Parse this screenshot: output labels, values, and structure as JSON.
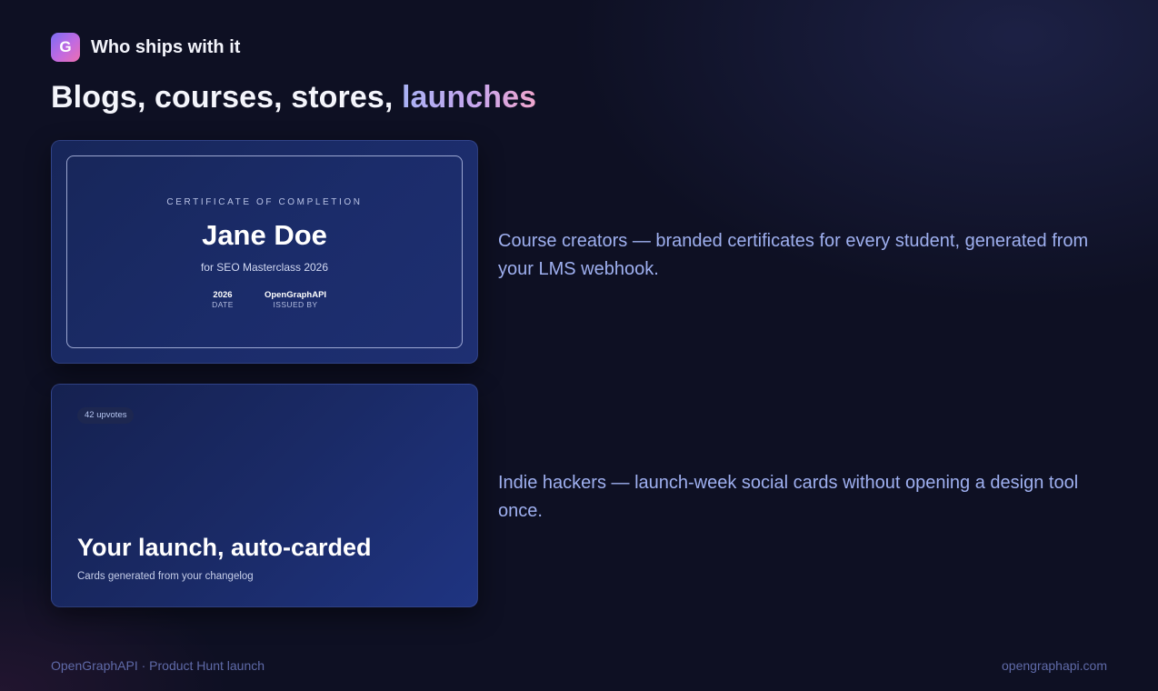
{
  "header": {
    "logo_letter": "G",
    "eyebrow": "Who ships with it",
    "headline_plain": "Blogs, courses, stores,",
    "headline_accent": "launches",
    "accent_gradient": [
      "#a9b2f4",
      "#c7a6ee",
      "#f0a6cd"
    ]
  },
  "showcase": [
    {
      "card": {
        "type": "certificate",
        "eyebrow": "CERTIFICATE OF COMPLETION",
        "name": "Jane Doe",
        "course": "for SEO Masterclass 2026",
        "date_value": "2026",
        "date_label": "DATE",
        "issuer_value": "OpenGraphAPI",
        "issuer_label": "ISSUED BY"
      },
      "description": "Course creators — branded certificates for every student, generated from your LMS webhook."
    },
    {
      "card": {
        "type": "launch",
        "badge": "42 upvotes",
        "title": "Your launch, auto-carded",
        "subtitle": "Cards generated from your changelog"
      },
      "description": "Indie hackers — launch-week social cards without opening a design tool once."
    }
  ],
  "footer": {
    "left": "OpenGraphAPI · Product Hunt launch",
    "right": "opengraphapi.com"
  },
  "colors": {
    "background": "#0e1023",
    "description_text": "#9fb0f0",
    "footer_text": "#5f6aa8",
    "card_blue": "#1b2c6a"
  }
}
